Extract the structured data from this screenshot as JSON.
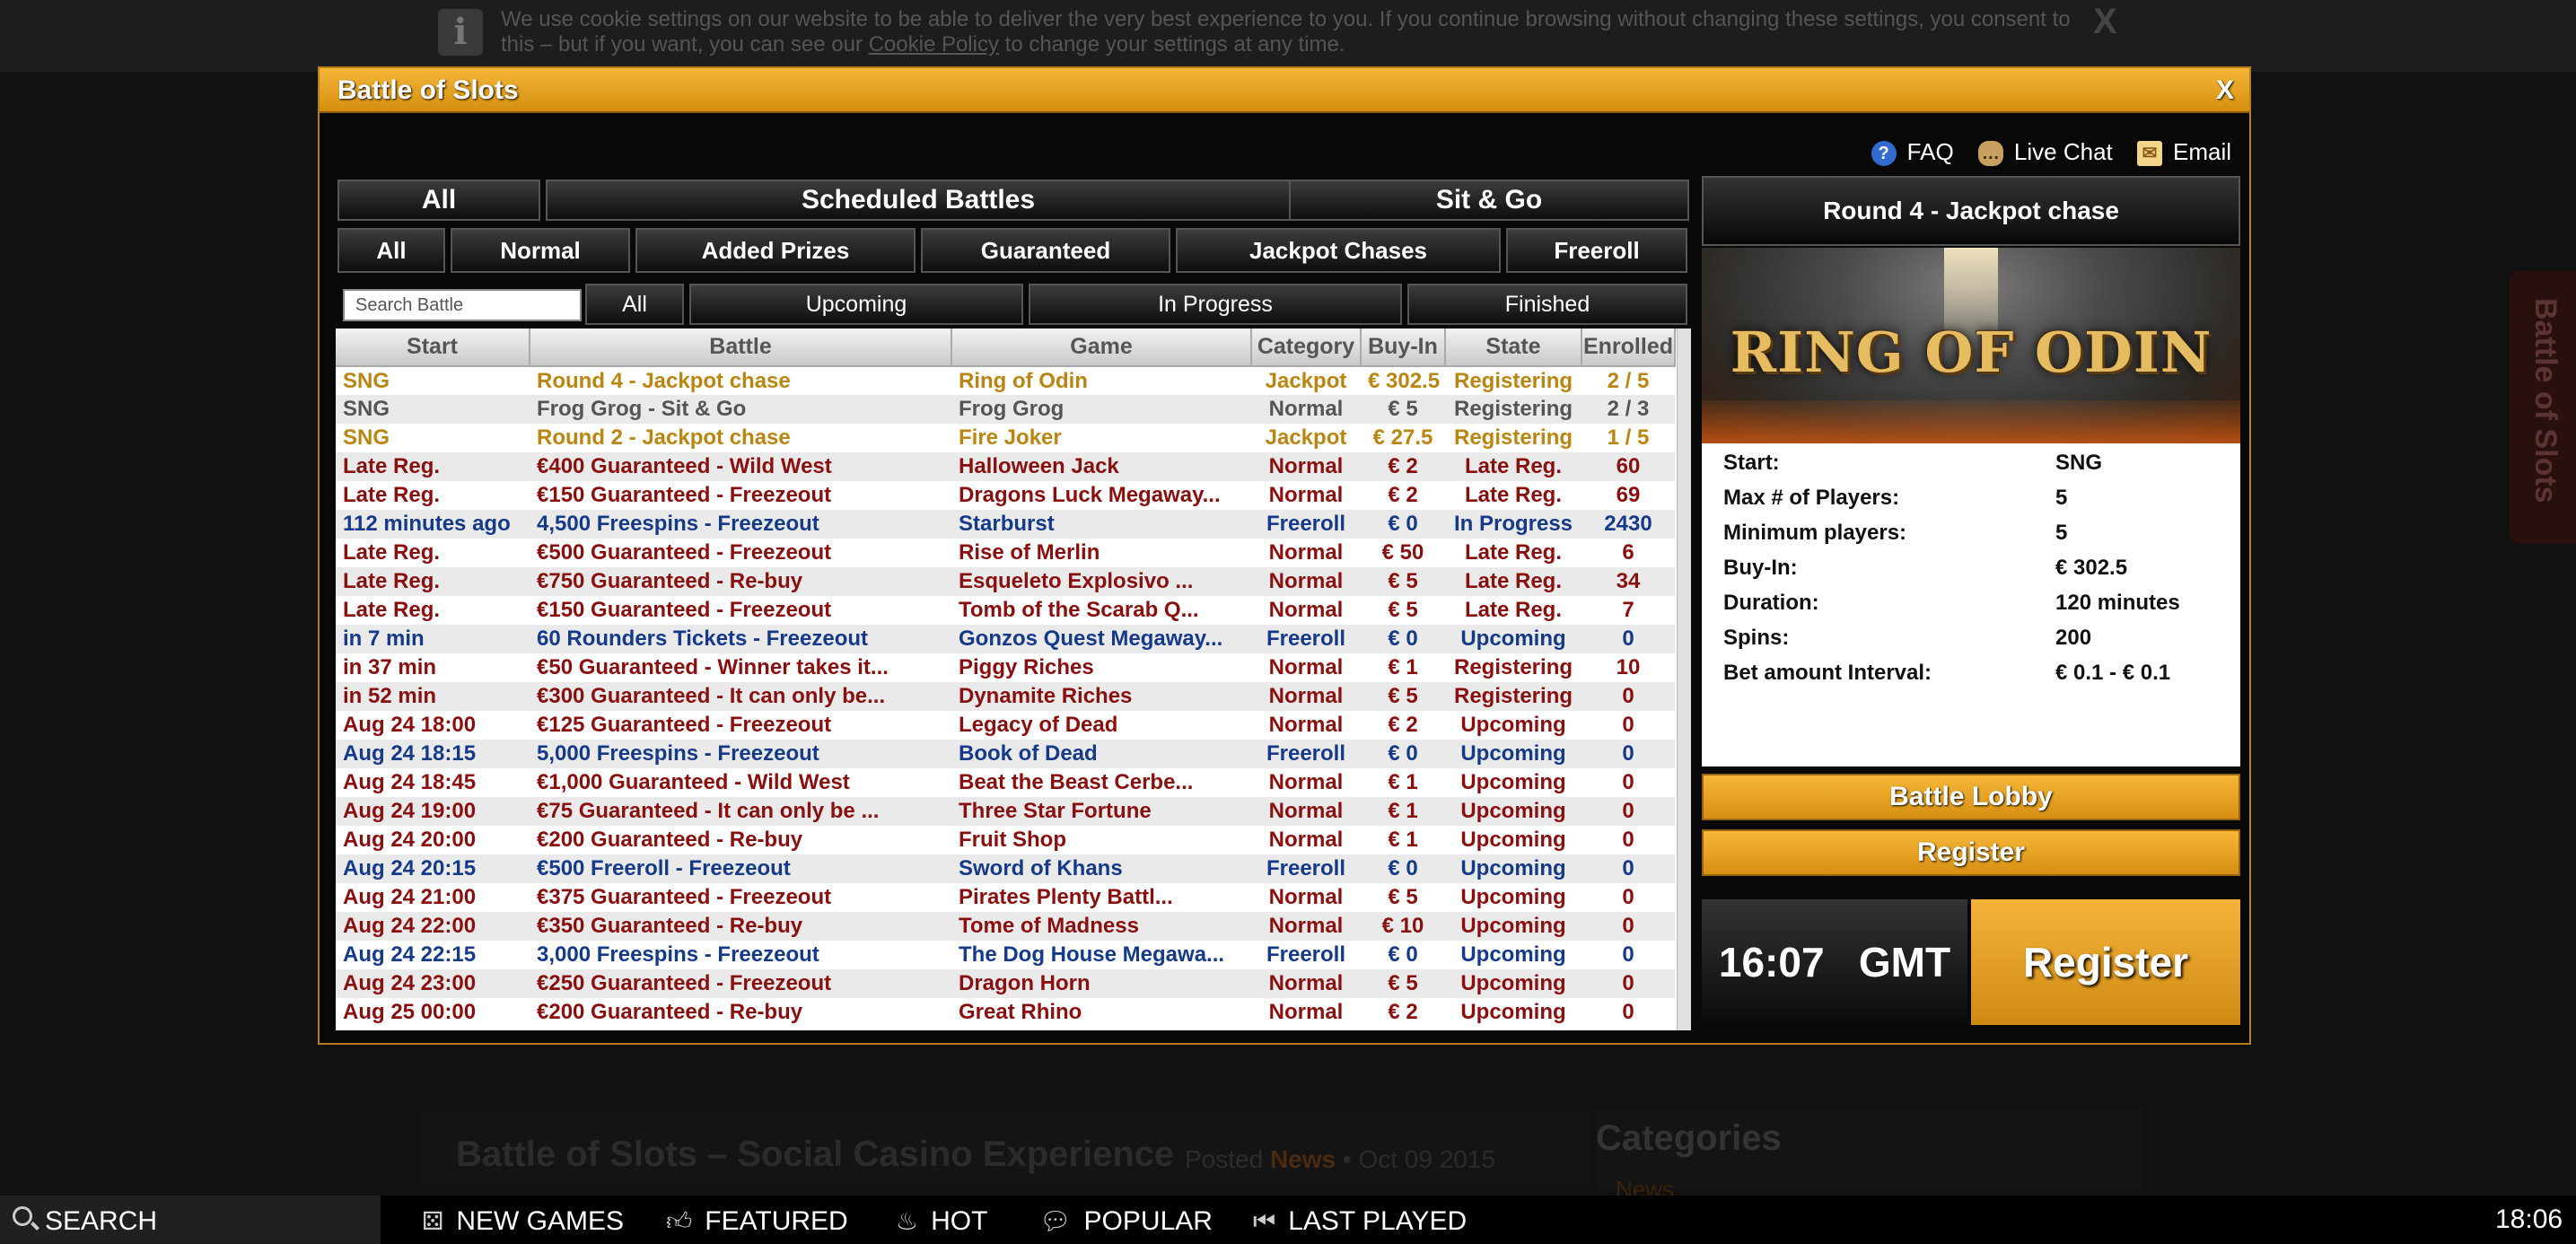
{
  "cookie": {
    "text_before": "We use cookie settings on our website to be able to deliver the very best experience to you. If you continue browsing without changing these settings, you consent to this – but if you want, you can see our ",
    "link": "Cookie Policy",
    "text_after": " to change your settings at any time.",
    "close": "X"
  },
  "side_tab": "Battle of Slots",
  "page": {
    "heading": "Battle of Slots – Social Casino Experience",
    "posted_label": "Posted",
    "posted_cat": "News",
    "posted_date": "• Oct 09 2015",
    "categories_heading": "Categories",
    "categories_first": "News"
  },
  "bottom_bar": {
    "search": "SEARCH",
    "items": [
      {
        "label": "NEW GAMES",
        "icon": "dice-icon"
      },
      {
        "label": "FEATURED",
        "icon": "thumbs-up-icon"
      },
      {
        "label": "HOT",
        "icon": "flame-icon"
      },
      {
        "label": "POPULAR",
        "icon": "chat-bubble-icon"
      },
      {
        "label": "LAST PLAYED",
        "icon": "rewind-icon"
      }
    ],
    "clock": "18:06"
  },
  "modal": {
    "title": "Battle of Slots",
    "close": "X",
    "links": {
      "faq": "FAQ",
      "chat": "Live Chat",
      "email": "Email"
    },
    "tabs_top": [
      "All",
      "Scheduled Battles",
      "Sit & Go"
    ],
    "tabs_type": [
      "All",
      "Normal",
      "Added Prizes",
      "Guaranteed",
      "Jackpot Chases",
      "Freeroll"
    ],
    "search_placeholder": "Search Battle",
    "tabs_state": [
      "All",
      "Upcoming",
      "In Progress",
      "Finished"
    ],
    "columns": [
      "Start",
      "Battle",
      "Game",
      "Category",
      "Buy-In",
      "State",
      "Enrolled"
    ],
    "rows": [
      {
        "start": "SNG",
        "battle": "Round 4 - Jackpot chase",
        "game": "Ring of Odin",
        "category": "Jackpot",
        "buyin": "€ 302.5",
        "state": "Registering",
        "enrolled": "2 / 5",
        "color": "gold"
      },
      {
        "start": "SNG",
        "battle": "Frog Grog - Sit & Go",
        "game": "Frog Grog",
        "category": "Normal",
        "buyin": "€ 5",
        "state": "Registering",
        "enrolled": "2 / 3",
        "color": "grey"
      },
      {
        "start": "SNG",
        "battle": "Round 2 - Jackpot chase",
        "game": "Fire Joker",
        "category": "Jackpot",
        "buyin": "€ 27.5",
        "state": "Registering",
        "enrolled": "1 / 5",
        "color": "gold"
      },
      {
        "start": "Late Reg.",
        "battle": "€400 Guaranteed - Wild West",
        "game": "Halloween Jack",
        "category": "Normal",
        "buyin": "€ 2",
        "state": "Late Reg.",
        "enrolled": "60",
        "color": "red"
      },
      {
        "start": "Late Reg.",
        "battle": "€150 Guaranteed - Freezeout",
        "game": "Dragons Luck Megaway...",
        "category": "Normal",
        "buyin": "€ 2",
        "state": "Late Reg.",
        "enrolled": "69",
        "color": "red"
      },
      {
        "start": "112 minutes ago",
        "battle": "4,500 Freespins - Freezeout",
        "game": "Starburst",
        "category": "Freeroll",
        "buyin": "€ 0",
        "state": "In Progress",
        "enrolled": "2430",
        "color": "blue"
      },
      {
        "start": "Late Reg.",
        "battle": "€500 Guaranteed - Freezeout",
        "game": "Rise of Merlin",
        "category": "Normal",
        "buyin": "€ 50",
        "state": "Late Reg.",
        "enrolled": "6",
        "color": "red"
      },
      {
        "start": "Late Reg.",
        "battle": "€750 Guaranteed - Re-buy",
        "game": "Esqueleto Explosivo ...",
        "category": "Normal",
        "buyin": "€ 5",
        "state": "Late Reg.",
        "enrolled": "34",
        "color": "red"
      },
      {
        "start": "Late Reg.",
        "battle": "€150 Guaranteed - Freezeout",
        "game": "Tomb of the Scarab Q...",
        "category": "Normal",
        "buyin": "€ 5",
        "state": "Late Reg.",
        "enrolled": "7",
        "color": "red"
      },
      {
        "start": "in 7 min",
        "battle": "60 Rounders Tickets - Freezeout",
        "game": "Gonzos Quest Megaway...",
        "category": "Freeroll",
        "buyin": "€ 0",
        "state": "Upcoming",
        "enrolled": "0",
        "color": "blue"
      },
      {
        "start": "in 37 min",
        "battle": "€50 Guaranteed - Winner takes it...",
        "game": "Piggy Riches",
        "category": "Normal",
        "buyin": "€ 1",
        "state": "Registering",
        "enrolled": "10",
        "color": "red"
      },
      {
        "start": "in 52 min",
        "battle": "€300 Guaranteed - It can only be...",
        "game": "Dynamite Riches",
        "category": "Normal",
        "buyin": "€ 5",
        "state": "Registering",
        "enrolled": "0",
        "color": "red"
      },
      {
        "start": "Aug 24 18:00",
        "battle": "€125 Guaranteed - Freezeout",
        "game": "Legacy of Dead",
        "category": "Normal",
        "buyin": "€ 2",
        "state": "Upcoming",
        "enrolled": "0",
        "color": "red"
      },
      {
        "start": "Aug 24 18:15",
        "battle": "5,000 Freespins - Freezeout",
        "game": "Book of Dead",
        "category": "Freeroll",
        "buyin": "€ 0",
        "state": "Upcoming",
        "enrolled": "0",
        "color": "blue"
      },
      {
        "start": "Aug 24 18:45",
        "battle": "€1,000 Guaranteed - Wild West",
        "game": "Beat the Beast Cerbe...",
        "category": "Normal",
        "buyin": "€ 1",
        "state": "Upcoming",
        "enrolled": "0",
        "color": "red"
      },
      {
        "start": "Aug 24 19:00",
        "battle": "€75 Guaranteed - It can only be ...",
        "game": "Three Star Fortune",
        "category": "Normal",
        "buyin": "€ 1",
        "state": "Upcoming",
        "enrolled": "0",
        "color": "red"
      },
      {
        "start": "Aug 24 20:00",
        "battle": "€200 Guaranteed - Re-buy",
        "game": "Fruit Shop",
        "category": "Normal",
        "buyin": "€ 1",
        "state": "Upcoming",
        "enrolled": "0",
        "color": "red"
      },
      {
        "start": "Aug 24 20:15",
        "battle": "€500 Freeroll - Freezeout",
        "game": "Sword of Khans",
        "category": "Freeroll",
        "buyin": "€ 0",
        "state": "Upcoming",
        "enrolled": "0",
        "color": "blue"
      },
      {
        "start": "Aug 24 21:00",
        "battle": "€375 Guaranteed - Freezeout",
        "game": "Pirates Plenty Battl...",
        "category": "Normal",
        "buyin": "€ 5",
        "state": "Upcoming",
        "enrolled": "0",
        "color": "red"
      },
      {
        "start": "Aug 24 22:00",
        "battle": "€350 Guaranteed - Re-buy",
        "game": "Tome of Madness",
        "category": "Normal",
        "buyin": "€ 10",
        "state": "Upcoming",
        "enrolled": "0",
        "color": "red"
      },
      {
        "start": "Aug 24 22:15",
        "battle": "3,000 Freespins - Freezeout",
        "game": "The Dog House Megawa...",
        "category": "Freeroll",
        "buyin": "€ 0",
        "state": "Upcoming",
        "enrolled": "0",
        "color": "blue"
      },
      {
        "start": "Aug 24 23:00",
        "battle": "€250 Guaranteed - Freezeout",
        "game": "Dragon Horn",
        "category": "Normal",
        "buyin": "€ 5",
        "state": "Upcoming",
        "enrolled": "0",
        "color": "red"
      },
      {
        "start": "Aug 25 00:00",
        "battle": "€200 Guaranteed - Re-buy",
        "game": "Great Rhino",
        "category": "Normal",
        "buyin": "€ 2",
        "state": "Upcoming",
        "enrolled": "0",
        "color": "red"
      }
    ],
    "detail": {
      "title": "Round 4 - Jackpot chase",
      "game_logo": "RING OF ODIN",
      "info": [
        {
          "k": "Start:",
          "v": "SNG"
        },
        {
          "k": "Max # of Players:",
          "v": "5"
        },
        {
          "k": "Minimum players:",
          "v": "5"
        },
        {
          "k": "Buy-In:",
          "v": "€ 302.5"
        },
        {
          "k": "Duration:",
          "v": "120 minutes"
        },
        {
          "k": "Spins:",
          "v": "200"
        },
        {
          "k": "Bet amount Interval:",
          "v": "€ 0.1 - € 0.1"
        }
      ],
      "lobby_button": "Battle Lobby",
      "register_button": "Register",
      "time": "16:07",
      "timezone": "GMT",
      "register_big": "Register"
    }
  },
  "colors": {
    "accent": "#e3a124",
    "gold_row": "#b98612",
    "red_row": "#8a1010",
    "blue_row": "#163a8a",
    "grey_row": "#555555"
  }
}
